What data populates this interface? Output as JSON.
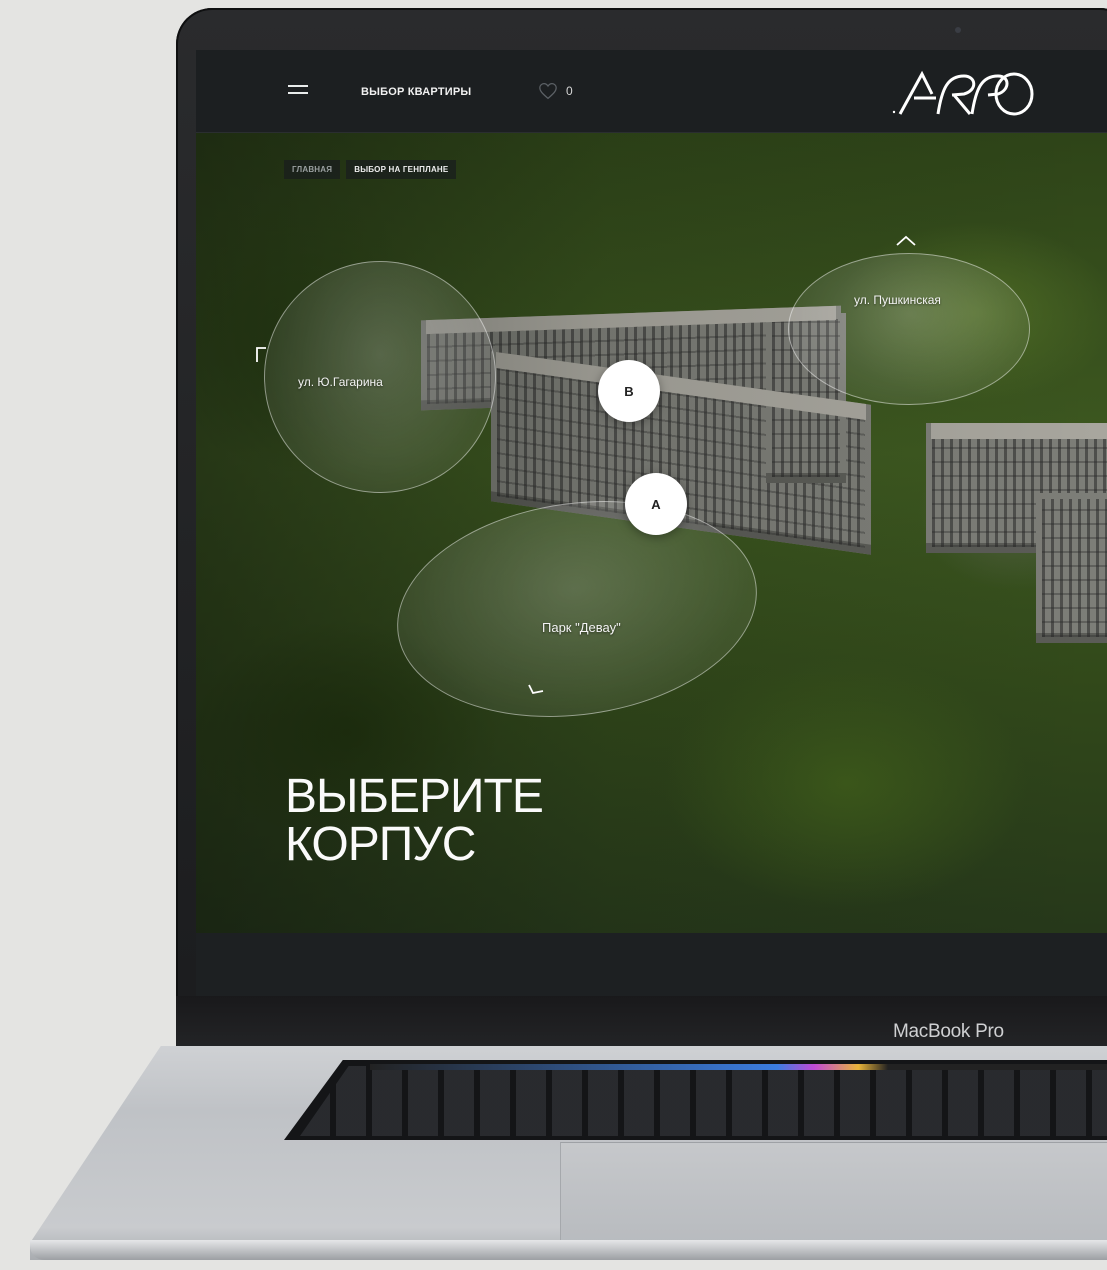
{
  "header": {
    "nav_label": "ВЫБОР КВАРТИРЫ",
    "favorites_count": "0",
    "logo_text": "ARRO"
  },
  "breadcrumb": [
    {
      "label": "ГЛАВНАЯ"
    },
    {
      "label": "ВЫБОР НА ГЕНПЛАНЕ"
    }
  ],
  "map": {
    "streets": {
      "gagarina": "ул. Ю.Гагарина",
      "pushkinskaya": "ул. Пушкинская",
      "park": "Парк \"Девау\""
    },
    "buildings": [
      {
        "label": "В"
      },
      {
        "label": "А"
      }
    ]
  },
  "hero": {
    "title_line1": "ВЫБЕРИТЕ",
    "title_line2": "КОРПУС"
  },
  "device": {
    "label": "MacBook Pro"
  },
  "colors": {
    "header_bg": "#1c1f21",
    "pin_bg": "#ffffff",
    "text_light": "#fafafa"
  }
}
